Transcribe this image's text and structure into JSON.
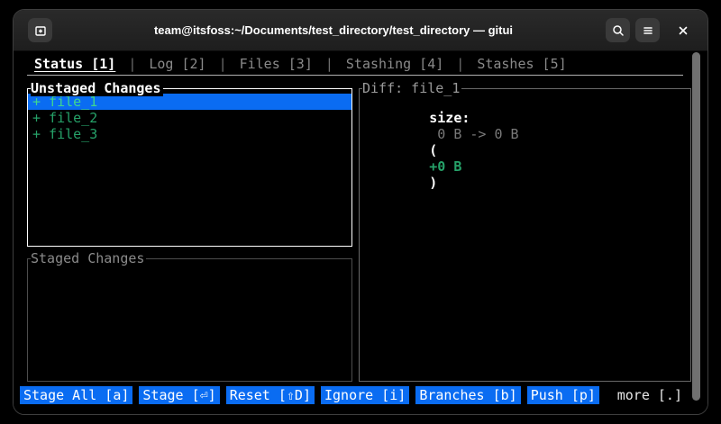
{
  "titlebar": {
    "title": "team@itsfoss:~/Documents/test_directory/test_directory — gitui"
  },
  "tabs": {
    "separator": "|",
    "items": [
      {
        "label": "Status [1]",
        "active": true
      },
      {
        "label": "Log [2]",
        "active": false
      },
      {
        "label": "Files [3]",
        "active": false
      },
      {
        "label": "Stashing [4]",
        "active": false
      },
      {
        "label": "Stashes [5]",
        "active": false
      }
    ]
  },
  "unstaged": {
    "title": "Unstaged Changes",
    "items": [
      {
        "label": "+ file_1",
        "selected": true
      },
      {
        "label": "+ file_2",
        "selected": false
      },
      {
        "label": "+ file_3",
        "selected": false
      }
    ]
  },
  "staged": {
    "title": "Staged Changes"
  },
  "diff": {
    "title": "Diff: file_1",
    "size_label": "size:",
    "size_values": " 0 B -> 0 B ",
    "paren_open": "(",
    "delta": "+0 B",
    "paren_close": ")"
  },
  "toolbar": {
    "buttons": [
      {
        "label": "Stage All [a]"
      },
      {
        "label": "Stage [⏎]"
      },
      {
        "label": "Reset [⇧D]"
      },
      {
        "label": "Ignore [i]"
      },
      {
        "label": "Branches [b]"
      },
      {
        "label": "Push [p]"
      }
    ],
    "more_label": "more [.]"
  },
  "icons": {
    "new_tab": "new-tab-icon",
    "search": "search-icon",
    "menu": "hamburger-menu-icon",
    "close": "close-icon"
  },
  "colors": {
    "selection_blue": "#0a6cf2",
    "added_green": "#26a269",
    "selected_item_green": "#3fd68f",
    "inactive_gray": "#8a8a8a",
    "focused_border": "#ffffff",
    "unfocused_border": "#686868",
    "terminal_background": "#000000",
    "headerbar_background": "#232323"
  }
}
